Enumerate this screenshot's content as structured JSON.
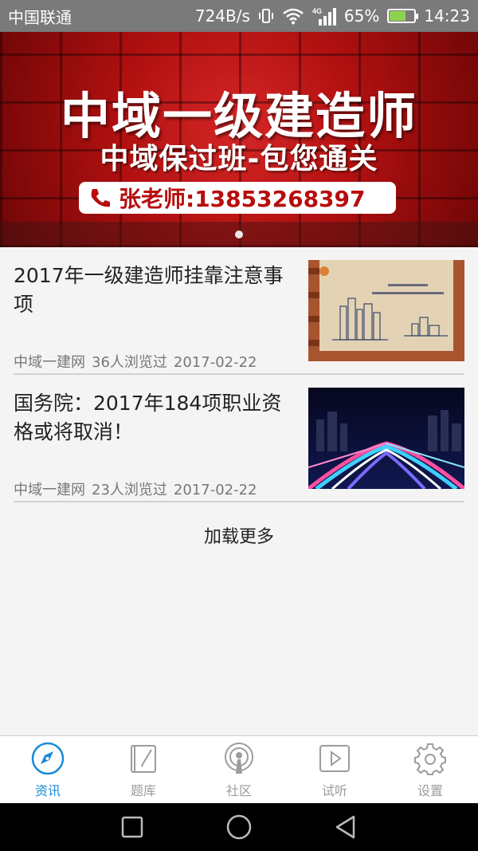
{
  "status_bar": {
    "carrier": "中国联通",
    "speed": "724B/s",
    "network": "4G",
    "battery": "65%",
    "battery_level": 0.65,
    "time": "14:23",
    "icons": [
      "vibrate-icon",
      "wifi-icon",
      "signal-icon",
      "battery-icon"
    ]
  },
  "banner": {
    "title": "中域一级建造师",
    "subtitle": "中域保过班-包您通关",
    "phone": "张老师:13853268397",
    "active_slide": 1,
    "slide_count": 1
  },
  "news": [
    {
      "title": "2017年一级建造师挂靠注意事项",
      "source": "中域一建网",
      "views": "36人浏览过",
      "date": "2017-02-22",
      "thumbnail": "city-sketch-image"
    },
    {
      "title": "国务院：2017年184项职业资格或将取消！",
      "source": "中域一建网",
      "views": "23人浏览过",
      "date": "2017-02-22",
      "thumbnail": "night-highway-image"
    }
  ],
  "load_more": "加载更多",
  "tabs": [
    {
      "label": "资讯",
      "icon": "compass-icon",
      "active": true
    },
    {
      "label": "题库",
      "icon": "notebook-icon",
      "active": false
    },
    {
      "label": "社区",
      "icon": "broadcast-icon",
      "active": false
    },
    {
      "label": "试听",
      "icon": "play-icon",
      "active": false
    },
    {
      "label": "设置",
      "icon": "gear-icon",
      "active": false
    }
  ],
  "colors": {
    "accent": "#1a8ad8",
    "tab_inactive": "#9c9c9c",
    "banner_red": "#c41515"
  }
}
